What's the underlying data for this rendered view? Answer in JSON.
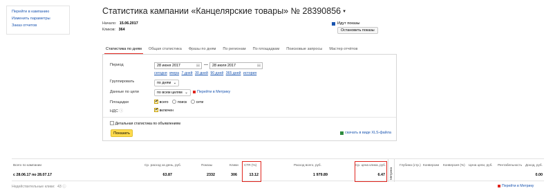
{
  "sidebar": {
    "links": [
      "Перейти в кампанию",
      "Изменить параметры",
      "Заказ отчетов"
    ]
  },
  "campaign": {
    "title": "Статистика кампании «Канцелярские товары» № 28390856",
    "start_label": "Начало:",
    "start_value": "15.06.2017",
    "clicks_label": "Кликов:",
    "clicks_value": "364",
    "status": "Идут показы",
    "stop_button": "Остановить показы"
  },
  "tabs": [
    "Статистика по дням",
    "Общая статистика",
    "Фразы по дням",
    "По регионам",
    "По площадкам",
    "Поисковые запросы",
    "Мастер отчётов"
  ],
  "filters": {
    "period_label": "Период",
    "date_from": "28 июня 2017",
    "date_to": "28 июля 2017",
    "quick_periods": [
      "сегодня",
      "вчера",
      "7 дней",
      "30 дней",
      "90 дней",
      "365 дней",
      "история"
    ],
    "group_label": "Группировать",
    "group_value": "по дням",
    "goals_label": "Данные по цели",
    "goals_value": "по всем целям",
    "metrika_link": "Перейти в Метрику",
    "platforms_label": "Площадки",
    "platform_options": [
      "всего",
      "поиск",
      "сети"
    ],
    "vat_label": "НДС",
    "vat_option": "включен",
    "detailed_option": "Детальная статистика по объявлениям",
    "show_button": "Показать",
    "xls_link": "скачать в виде XLS-файла"
  },
  "stats": {
    "headers": {
      "total": "Всего по кампании",
      "avg_spend": "Ср. расход за день, руб.",
      "impressions": "Показы",
      "clicks": "Клики",
      "ctr": "CTR (%)",
      "spend": "Расход всего, руб.",
      "avg_cpc": "Ср. цена клика, руб.",
      "metrika": "Метрика",
      "depth": "Глубина (стр.)",
      "conversions": "Конверсии",
      "conv_rate": "Конверсия (%)",
      "cpa": "Цена цели, руб.",
      "profitability": "Рентабельность",
      "revenue": "Доход, руб."
    },
    "values": {
      "period": "с 28.06.17 по 28.07.17",
      "avg_spend": "63.87",
      "impressions": "2332",
      "clicks": "306",
      "ctr": "13.12",
      "spend": "1 979.89",
      "avg_cpc": "6.47",
      "revenue": "0.00"
    }
  },
  "footer": {
    "note": "Недействительные клики:",
    "note_count": "43",
    "metrika_link": "Перейти в Метрику"
  },
  "colors": {
    "link": "#1a55b0",
    "accent_red": "#e0241d",
    "button_yellow": "#ffdb4d"
  }
}
